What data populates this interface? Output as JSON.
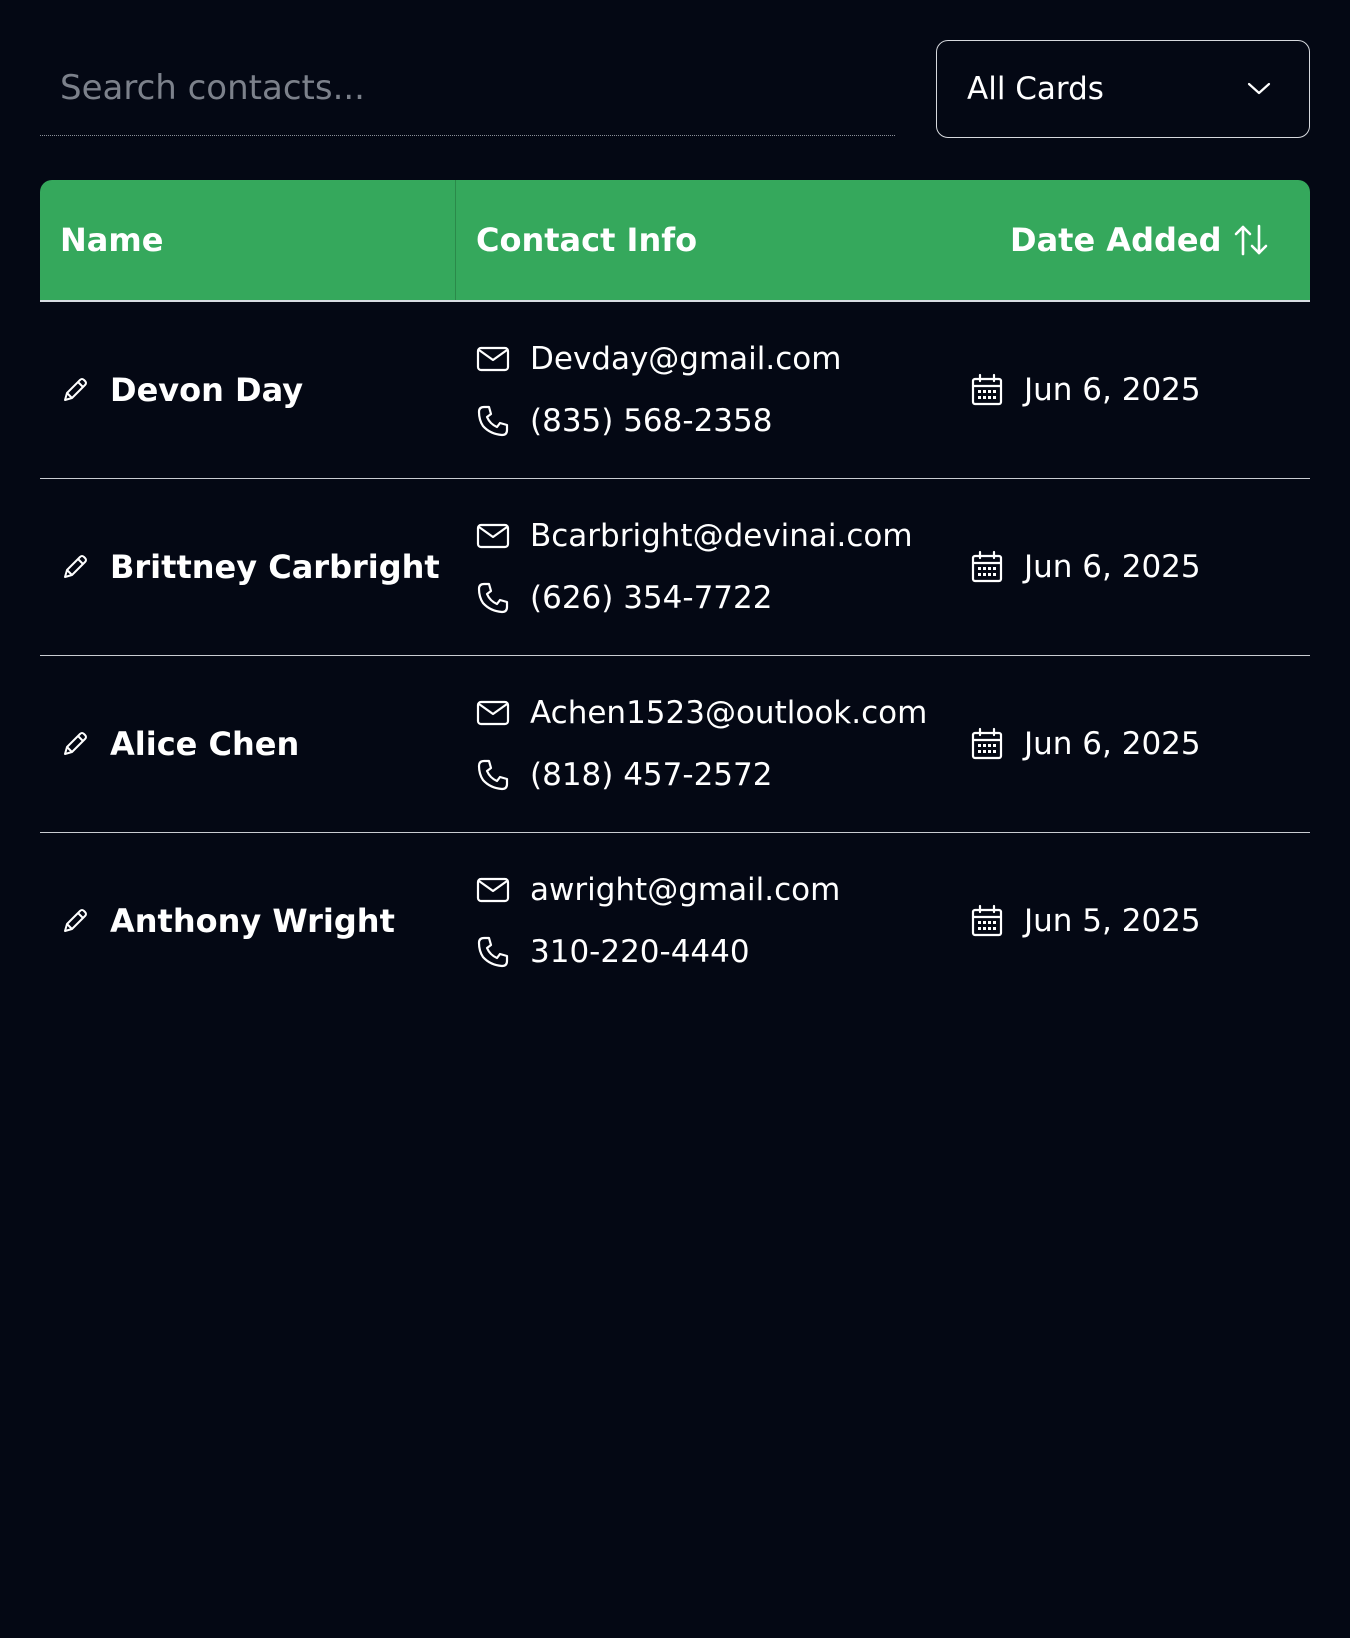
{
  "search": {
    "placeholder": "Search contacts...",
    "value": ""
  },
  "filter": {
    "selected": "All Cards"
  },
  "table": {
    "headers": {
      "name": "Name",
      "contact": "Contact Info",
      "date": "Date Added"
    },
    "rows": [
      {
        "name": "Devon Day",
        "email": "Devday@gmail.com",
        "phone": "(835) 568-2358",
        "date": "Jun 6, 2025"
      },
      {
        "name": "Brittney Carbright",
        "email": "Bcarbright@devinai.com",
        "phone": "(626) 354-7722",
        "date": "Jun 6, 2025"
      },
      {
        "name": "Alice Chen",
        "email": "Achen1523@outlook.com",
        "phone": "(818) 457-2572",
        "date": "Jun 6, 2025"
      },
      {
        "name": "Anthony Wright",
        "email": "awright@gmail.com",
        "phone": "310-220-4440",
        "date": "Jun 5, 2025"
      }
    ]
  },
  "colors": {
    "background": "#040814",
    "header": "#35a85c",
    "text": "#ffffff"
  }
}
